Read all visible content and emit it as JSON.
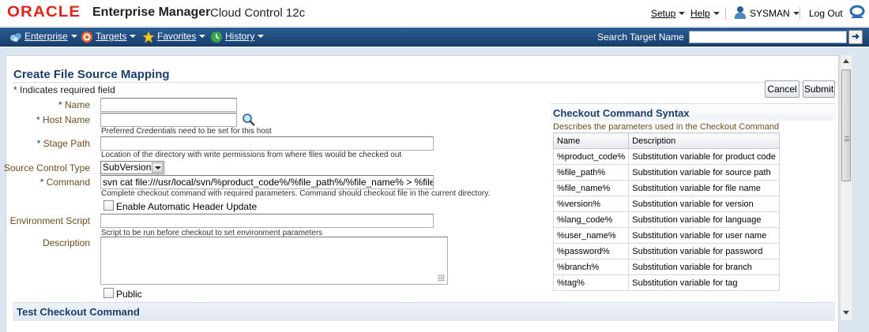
{
  "brand": {
    "oracle": "ORACLE",
    "product": "Enterprise Manager",
    "edition": "Cloud Control 12c"
  },
  "global_menu": {
    "setup": "Setup",
    "help": "Help",
    "user": "SYSMAN",
    "logout": "Log Out"
  },
  "nav": {
    "items": [
      {
        "label": "Enterprise",
        "icon": "enterprise-icon"
      },
      {
        "label": "Targets",
        "icon": "targets-icon"
      },
      {
        "label": "Favorites",
        "icon": "star-icon"
      },
      {
        "label": "History",
        "icon": "history-icon"
      }
    ],
    "search_label": "Search Target Name",
    "search_value": ""
  },
  "page": {
    "title": "Create File Source Mapping",
    "required_note": "Indicates required field",
    "cancel": "Cancel",
    "submit": "Submit"
  },
  "form": {
    "name": {
      "label": "Name",
      "value": ""
    },
    "host_name": {
      "label": "Host Name",
      "value": "",
      "hint": "Preferred Credentials need to be set for this host"
    },
    "stage_path": {
      "label": "Stage Path",
      "value": "",
      "hint": "Location of the directory with write permissions from where files would be checked out"
    },
    "source_control_type": {
      "label": "Source Control Type",
      "value": "SubVersion"
    },
    "command": {
      "label": "Command",
      "value": "svn cat file:///usr/local/svn/%product_code%/%file_path%/%file_name% > %file_na",
      "hint": "Complete checkout command with required parameters. Command should checkout file in the current directory."
    },
    "auto_header": {
      "label": "Enable Automatic Header Update",
      "checked": false
    },
    "env_script": {
      "label": "Environment Script",
      "value": "",
      "hint": "Script to be run before checkout to set environment parameters"
    },
    "description": {
      "label": "Description",
      "value": ""
    },
    "public": {
      "label": "Public",
      "checked": false
    }
  },
  "syntax": {
    "title": "Checkout Command Syntax",
    "description": "Describes the parameters used in the Checkout Command",
    "columns": [
      "Name",
      "Description"
    ],
    "rows": [
      {
        "name": "%product_code%",
        "desc": "Substitution variable for product code"
      },
      {
        "name": "%file_path%",
        "desc": "Substitution variable for source path"
      },
      {
        "name": "%file_name%",
        "desc": "Substitution variable for file name"
      },
      {
        "name": "%version%",
        "desc": "Substitution variable for version"
      },
      {
        "name": "%lang_code%",
        "desc": "Substitution variable for language"
      },
      {
        "name": "%user_name%",
        "desc": "Substitution variable for user name"
      },
      {
        "name": "%password%",
        "desc": "Substitution variable for password"
      },
      {
        "name": "%branch%",
        "desc": "Substitution variable for branch"
      },
      {
        "name": "%tag%",
        "desc": "Substitution variable for tag"
      }
    ]
  },
  "test_section": {
    "title": "Test Checkout Command"
  },
  "colors": {
    "brand_red": "#e2231a",
    "nav_blue": "#1f4a7e",
    "title_blue": "#1b3f6e",
    "label_brown": "#6b4d1e"
  }
}
